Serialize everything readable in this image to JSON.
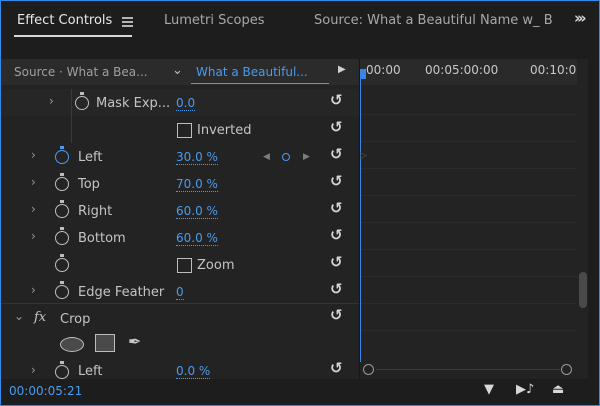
{
  "tabs": [
    {
      "label": "Effect Controls",
      "active": true
    },
    {
      "label": "Lumetri Scopes"
    },
    {
      "label": "Source: What a Beautiful Name w_ B"
    }
  ],
  "source": {
    "left": "Source · What a Bea...",
    "right": "What a Beautiful..."
  },
  "ruler": {
    "ticks": [
      "00:00",
      "00:05:00:00",
      "00:10:0"
    ]
  },
  "rows": {
    "mask_expansion": {
      "label": "Mask Exp...",
      "value": "0.0"
    },
    "inverted": {
      "label": "Inverted"
    },
    "left": {
      "label": "Left",
      "value": "30.0",
      "unit": "%"
    },
    "top": {
      "label": "Top",
      "value": "70.0",
      "unit": "%"
    },
    "right": {
      "label": "Right",
      "value": "60.0",
      "unit": "%"
    },
    "bottom": {
      "label": "Bottom",
      "value": "60.0",
      "unit": "%"
    },
    "zoom": {
      "label": "Zoom"
    },
    "edge_feather": {
      "label": "Edge Feather",
      "value": "0"
    },
    "crop": {
      "fx": "fx",
      "label": "Crop"
    },
    "crop_left": {
      "label": "Left",
      "value": "0.0",
      "unit": "%"
    }
  },
  "footer": {
    "timecode": "00:00:05:21"
  },
  "colors": {
    "accent": "#4a9bed",
    "playhead": "#3a86e8",
    "panel": "#232323"
  }
}
